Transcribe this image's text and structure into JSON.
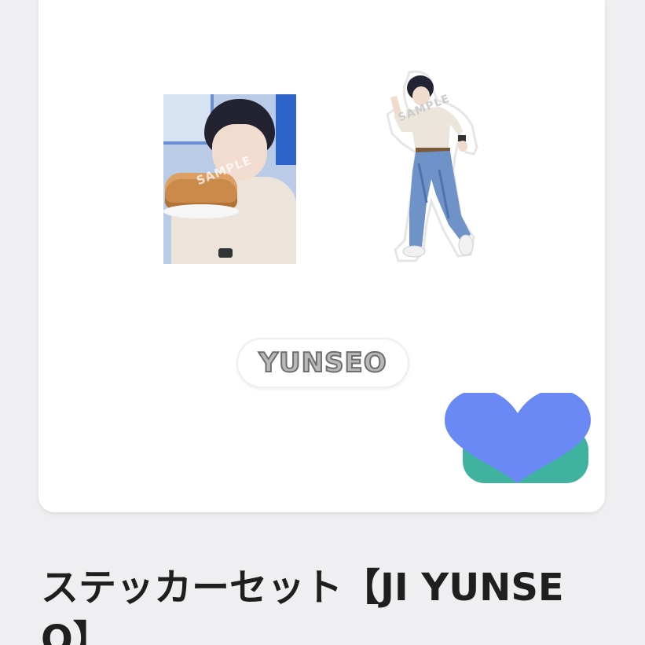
{
  "product": {
    "title": "ステッカーセット【JI YUNSEO】",
    "sticker_name": "YUNSEO",
    "watermark": "SAMPLE",
    "watermark_person": "SAMPLE"
  },
  "icons": {
    "heart": "heart-icon"
  },
  "colors": {
    "page_bg": "#efeff1",
    "card_bg": "#ffffff",
    "heart_front": "#6b89f5",
    "heart_back": "#3fb3a0",
    "title_text": "#1f1f1f"
  }
}
